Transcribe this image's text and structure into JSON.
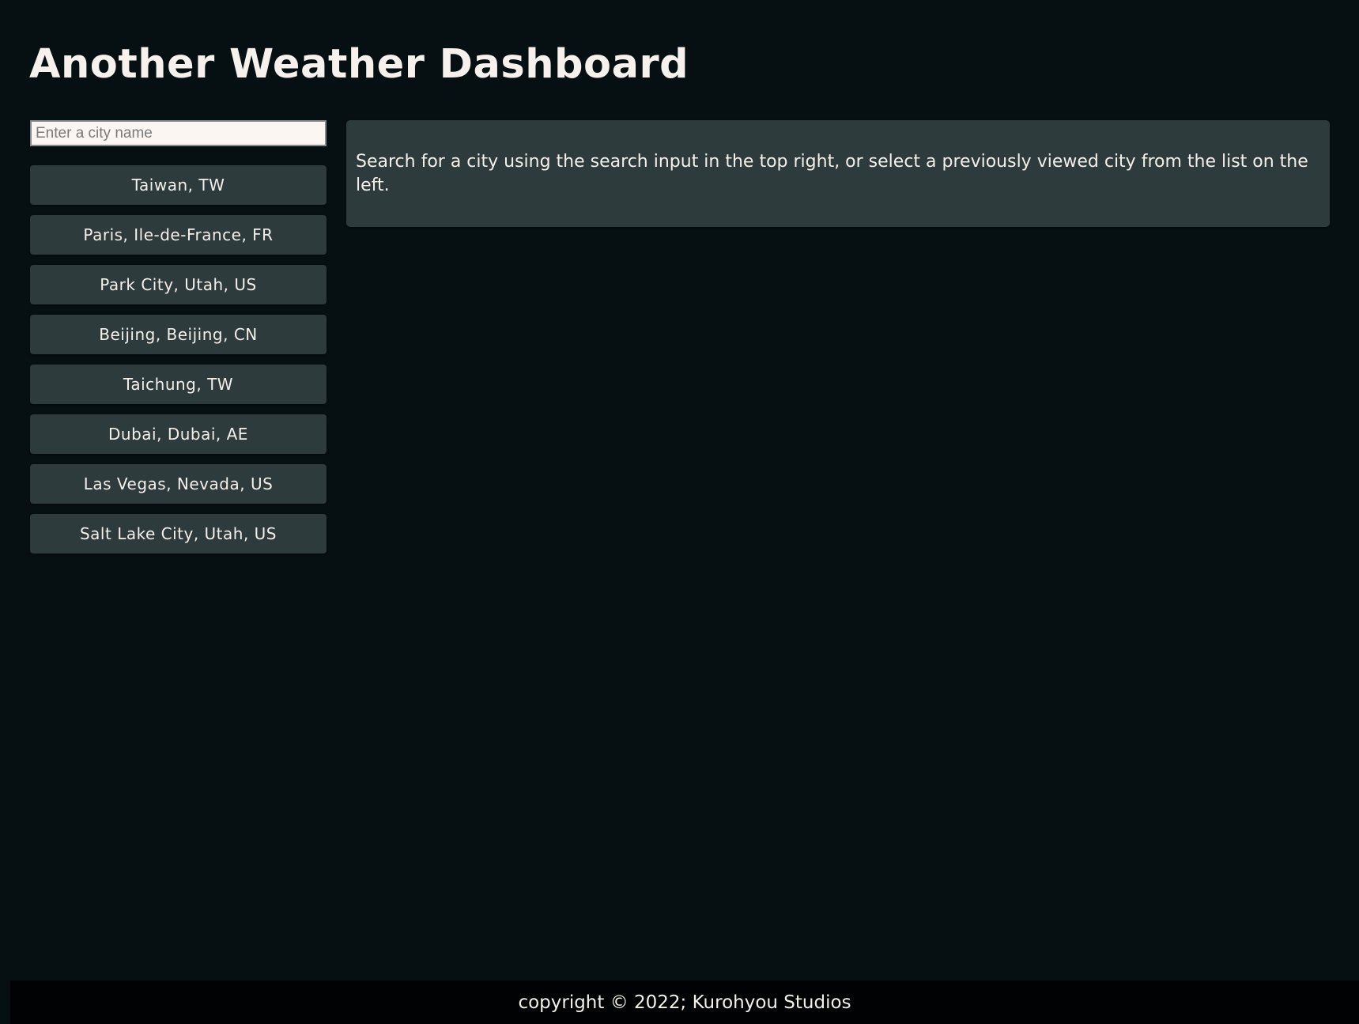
{
  "header": {
    "title": "Another Weather Dashboard"
  },
  "search": {
    "placeholder": "Enter a city name",
    "value": ""
  },
  "history": {
    "cities": [
      "Taiwan, TW",
      "Paris, Ile-de-France, FR",
      "Park City, Utah, US",
      "Beijing, Beijing, CN",
      "Taichung, TW",
      "Dubai, Dubai, AE",
      "Las Vegas, Nevada, US",
      "Salt Lake City, Utah, US"
    ]
  },
  "main": {
    "message": "Search for a city using the search input in the top right, or select a previously viewed city from the list on the left."
  },
  "footer": {
    "text": "copyright © 2022; Kurohyou Studios"
  },
  "colors": {
    "background": "#061012",
    "panel": "#2d3b3c",
    "text": "#f4efe9",
    "footer_background": "#010203"
  }
}
